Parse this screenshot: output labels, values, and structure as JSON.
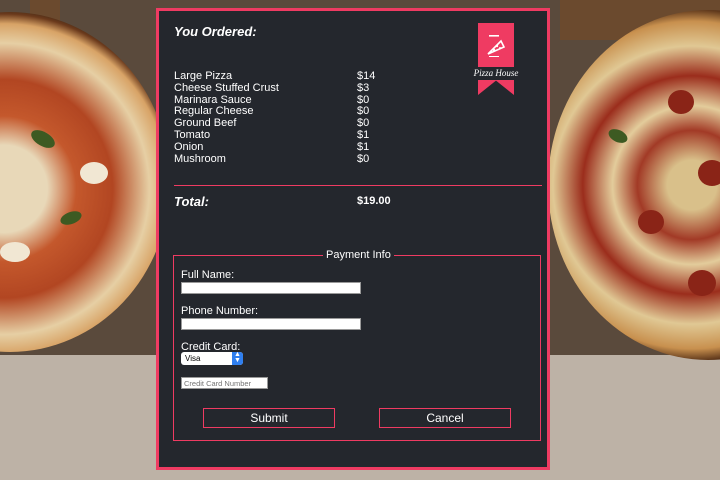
{
  "colors": {
    "accent": "#ef3b62",
    "panel_bg": "#24272d",
    "text": "#ffffff",
    "select_arrow": "#2f7ff0"
  },
  "order": {
    "title": "You Ordered:",
    "items": [
      {
        "name": "Large Pizza",
        "price": "$14"
      },
      {
        "name": "Cheese Stuffed Crust",
        "price": "$3"
      },
      {
        "name": "Marinara Sauce",
        "price": "$0"
      },
      {
        "name": "Regular Cheese",
        "price": "$0"
      },
      {
        "name": "Ground Beef",
        "price": "$0"
      },
      {
        "name": "Tomato",
        "price": "$1"
      },
      {
        "name": "Onion",
        "price": "$1"
      },
      {
        "name": "Mushroom",
        "price": "$0"
      }
    ],
    "total_label": "Total:",
    "total_value": "$19.00"
  },
  "logo": {
    "text": "Pizza House",
    "icon": "pizza-slice-icon"
  },
  "payment": {
    "legend": "Payment Info",
    "full_name_label": "Full Name:",
    "full_name_value": "",
    "phone_label": "Phone Number:",
    "phone_value": "",
    "credit_card_label": "Credit Card:",
    "card_type_selected": "Visa",
    "card_number_placeholder": "Credit Card Number",
    "submit_label": "Submit",
    "cancel_label": "Cancel"
  }
}
